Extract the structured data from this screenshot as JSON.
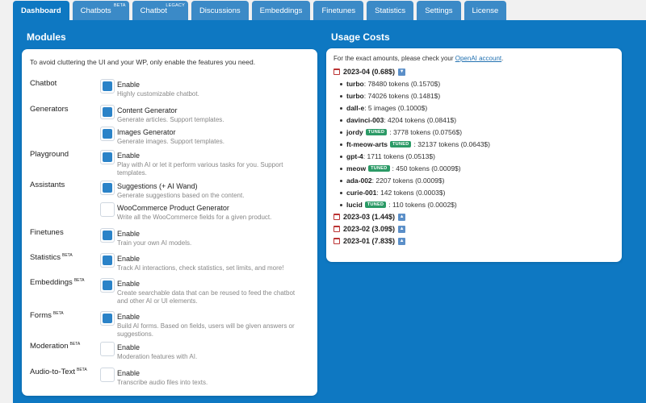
{
  "tabs": [
    {
      "label": "Dashboard",
      "beta": ""
    },
    {
      "label": "Chatbots",
      "beta": "BETA"
    },
    {
      "label": "Chatbot",
      "beta": "LEGACY"
    },
    {
      "label": "Discussions",
      "beta": ""
    },
    {
      "label": "Embeddings",
      "beta": ""
    },
    {
      "label": "Finetunes",
      "beta": ""
    },
    {
      "label": "Statistics",
      "beta": ""
    },
    {
      "label": "Settings",
      "beta": ""
    },
    {
      "label": "License",
      "beta": ""
    }
  ],
  "modules": {
    "title": "Modules",
    "intro": "To avoid cluttering the UI and your WP, only enable the features you need.",
    "rows": [
      {
        "label": "Chatbot",
        "beta": "",
        "options": [
          {
            "title": "Enable",
            "desc": "Highly customizable chatbot.",
            "checked": true
          }
        ]
      },
      {
        "label": "Generators",
        "beta": "",
        "options": [
          {
            "title": "Content Generator",
            "desc": "Generate articles. Support templates.",
            "checked": true
          },
          {
            "title": "Images Generator",
            "desc": "Generate images. Support templates.",
            "checked": true
          }
        ]
      },
      {
        "label": "Playground",
        "beta": "",
        "options": [
          {
            "title": "Enable",
            "desc": "Play with AI or let it perform various tasks for you. Support templates.",
            "checked": true
          }
        ]
      },
      {
        "label": "Assistants",
        "beta": "",
        "options": [
          {
            "title": "Suggestions (+ AI Wand)",
            "desc": "Generate suggestions based on the content.",
            "checked": true
          },
          {
            "title": "WooCommerce Product Generator",
            "desc": "Write all the WooCommerce fields for a given product.",
            "checked": false
          }
        ]
      },
      {
        "label": "Finetunes",
        "beta": "",
        "options": [
          {
            "title": "Enable",
            "desc": "Train your own AI models.",
            "checked": true
          }
        ]
      },
      {
        "label": "Statistics",
        "beta": "BETA",
        "options": [
          {
            "title": "Enable",
            "desc": "Track AI interactions, check statistics, set limits, and more!",
            "checked": true
          }
        ]
      },
      {
        "label": "Embeddings",
        "beta": "BETA",
        "options": [
          {
            "title": "Enable",
            "desc": "Create searchable data that can be reused to feed the chatbot and other AI or UI elements.",
            "checked": true
          }
        ]
      },
      {
        "label": "Forms",
        "beta": "BETA",
        "options": [
          {
            "title": "Enable",
            "desc": "Build AI forms. Based on fields, users will be given answers or suggestions.",
            "checked": true
          }
        ]
      },
      {
        "label": "Moderation",
        "beta": "BETA",
        "options": [
          {
            "title": "Enable",
            "desc": "Moderation features with AI.",
            "checked": false
          }
        ]
      },
      {
        "label": "Audio-to-Text",
        "beta": "BETA",
        "options": [
          {
            "title": "Enable",
            "desc": "Transcribe audio files into texts.",
            "checked": false
          }
        ]
      }
    ]
  },
  "usage": {
    "title": "Usage Costs",
    "note_prefix": "For the exact amounts, please check your ",
    "note_link": "OpenAI account",
    "note_suffix": ".",
    "months": [
      {
        "label": "2023-04 (0.68$)",
        "expanded": true,
        "arrow": "▼",
        "items": [
          {
            "model": "turbo",
            "tuned": false,
            "detail": ": 78480 tokens (0.1570$)"
          },
          {
            "model": "turbo",
            "tuned": false,
            "detail": ": 74026 tokens (0.1481$)"
          },
          {
            "model": "dall-e",
            "tuned": false,
            "detail": ": 5 images (0.1000$)"
          },
          {
            "model": "davinci-003",
            "tuned": false,
            "detail": ": 4204 tokens (0.0841$)"
          },
          {
            "model": "jordy",
            "tuned": true,
            "detail": ": 3778 tokens (0.0756$)"
          },
          {
            "model": "ft-meow-arts",
            "tuned": true,
            "detail": ": 32137 tokens (0.0643$)"
          },
          {
            "model": "gpt-4",
            "tuned": false,
            "detail": ": 1711 tokens (0.0513$)"
          },
          {
            "model": "meow",
            "tuned": true,
            "detail": ": 450 tokens (0.0009$)"
          },
          {
            "model": "ada-002",
            "tuned": false,
            "detail": ": 2207 tokens (0.0009$)"
          },
          {
            "model": "curie-001",
            "tuned": false,
            "detail": ": 142 tokens (0.0003$)"
          },
          {
            "model": "lucid",
            "tuned": true,
            "detail": ": 110 tokens (0.0002$)"
          }
        ]
      },
      {
        "label": "2023-03 (1.44$)",
        "expanded": false,
        "arrow": "▲",
        "items": []
      },
      {
        "label": "2023-02 (3.09$)",
        "expanded": false,
        "arrow": "▲",
        "items": []
      },
      {
        "label": "2023-01 (7.83$)",
        "expanded": false,
        "arrow": "▲",
        "items": []
      }
    ],
    "tuned_label": "TUNED"
  }
}
